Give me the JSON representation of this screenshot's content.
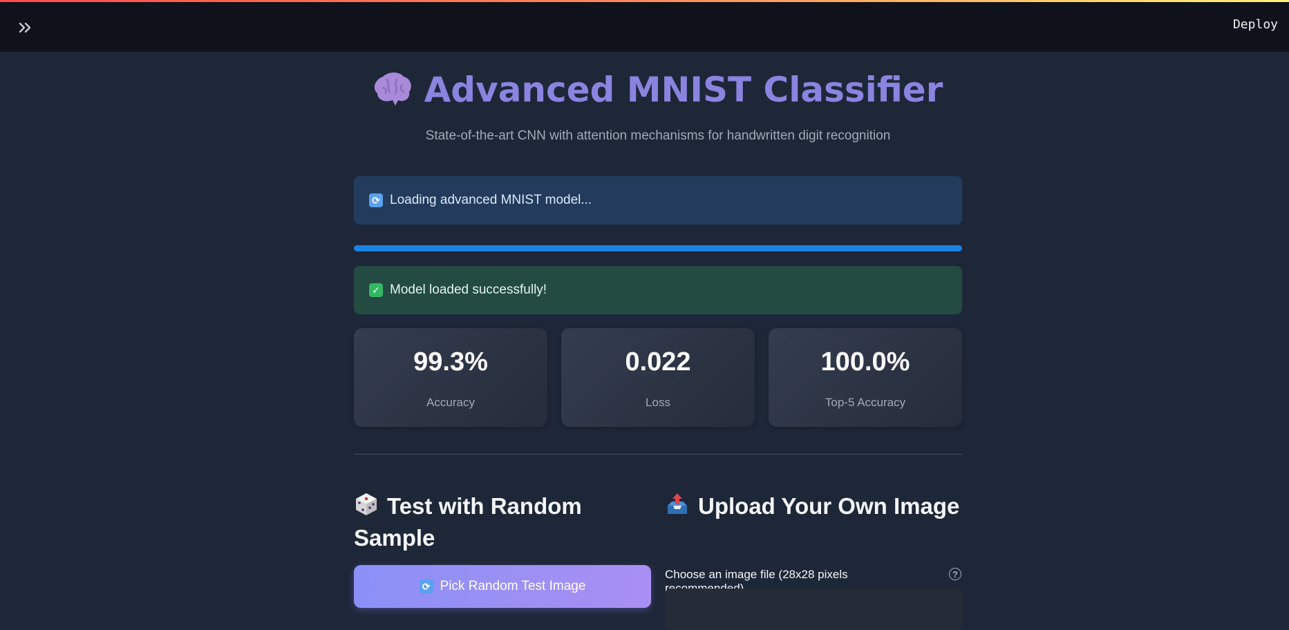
{
  "header": {
    "deploy_label": "Deploy"
  },
  "main": {
    "title": "Advanced MNIST Classifier",
    "subtitle": "State-of-the-art CNN with attention mechanisms for handwritten digit recognition",
    "info_alert": "Loading advanced MNIST model...",
    "progress": 1.0,
    "success_alert": "Model loaded successfully!",
    "metrics": [
      {
        "value": "99.3%",
        "label": "Accuracy"
      },
      {
        "value": "0.022",
        "label": "Loss"
      },
      {
        "value": "100.0%",
        "label": "Top-5 Accuracy"
      }
    ],
    "random_section": {
      "heading": "Test with Random Sample",
      "button_label": "Pick Random Test Image"
    },
    "upload_section": {
      "heading": "Upload Your Own Image",
      "file_label": "Choose an image file (28x28 pixels recommended)"
    }
  },
  "colors": {
    "accent_title": "#8a84e0",
    "info_bg": "#233c5d",
    "success_bg": "#234b42",
    "progress": "#1c83e1",
    "button_gradient_start": "#8b90f6",
    "button_gradient_end": "#a98ff3"
  }
}
